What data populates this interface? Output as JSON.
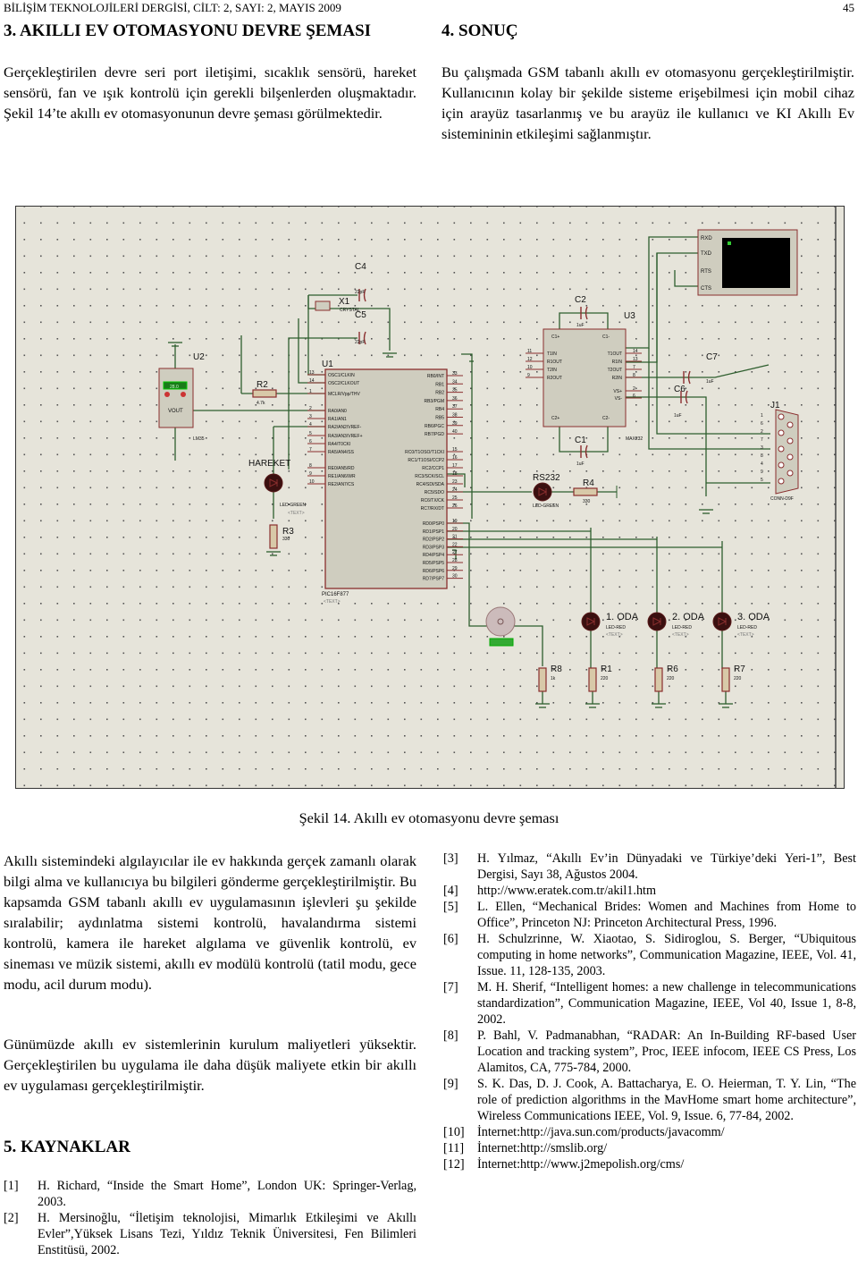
{
  "header": {
    "journal": "BİLİŞİM TEKNOLOJİLERİ DERGİSİ, CİLT: 2, SAYI: 2, MAYIS 2009",
    "page": "45"
  },
  "section3": {
    "title": "3. AKILLI EV OTOMASYONU DEVRE ŞEMASI",
    "text": "Gerçekleştirilen devre seri port iletişimi, sıcaklık sensörü, hareket sensörü, fan ve ışık kontrolü için gerekli bilşenlerden oluşmaktadır. Şekil 14’te akıllı ev otomasyonunun devre şeması görülmektedir."
  },
  "section4": {
    "title": "4. SONUÇ",
    "text": "Bu çalışmada GSM tabanlı akıllı ev otomasyonu gerçekleştirilmiştir. Kullanıcının kolay bir şekilde sisteme erişebilmesi için mobil cihaz için arayüz tasarlanmış ve bu arayüz ile kullanıcı ve KI Akıllı Ev sistemininin etkileşimi sağlanmıştır."
  },
  "figure": {
    "caption": "Şekil 14. Akıllı ev otomasyonu devre şeması",
    "labels": {
      "c4": "C4",
      "c4v": "22pF",
      "x1": "X1",
      "x1v": "CRYSTAL",
      "c5": "C5",
      "c5v": "22pF",
      "u1": "U1",
      "u1part": "PIC16F877",
      "u2": "U2",
      "u2part": "LM35",
      "u2pin": "VOUT",
      "u2val": "28.0",
      "r2": "R2",
      "r2v": "4.7k",
      "hareket": "HAREKET",
      "ledgreen": "LED-GREEN",
      "r3": "R3",
      "r3v": "330",
      "c2": "C2",
      "c2v": "1uF",
      "u3": "U3",
      "u3part": "MAX232",
      "c1": "C1",
      "c1v": "1uF",
      "c6": "C6",
      "c6v": "1uF",
      "c7": "C7",
      "c7v": "1uF",
      "j1": "J1",
      "j1part": "CONN-D9F",
      "rs232": "RS232",
      "ledgreen2": "LED-GREEN",
      "r4": "R4",
      "r4v": "330",
      "oda1": "1. ODA",
      "oda2": "2. ODA",
      "oda3": "3. ODA",
      "ledred": "LED-RED",
      "r8": "R8",
      "r8v": "1k",
      "r1": "R1",
      "r1v": "220",
      "r6": "R6",
      "r6v": "220",
      "r7": "R7",
      "r7v": "220",
      "text": "<TEXT>",
      "term": [
        "RXD",
        "TXD",
        "RTS",
        "CTS"
      ]
    },
    "u1_left": [
      [
        "13",
        "OSC1/CLKIN"
      ],
      [
        "14",
        "OSC2/CLKOUT"
      ],
      [
        "1",
        "MCLR/Vpp/THV"
      ],
      [
        "2",
        "RA0/AN0"
      ],
      [
        "3",
        "RA1/AN1"
      ],
      [
        "4",
        "RA2/AN2/VREF-"
      ],
      [
        "5",
        "RA3/AN3/VREF+"
      ],
      [
        "6",
        "RA4/T0CKI"
      ],
      [
        "7",
        "RA5/AN4/SS"
      ],
      [
        "8",
        "RE0/AN5/RD"
      ],
      [
        "9",
        "RE1/AN6/WR"
      ],
      [
        "10",
        "RE2/AN7/CS"
      ]
    ],
    "u1_right": [
      [
        "33",
        "RB0/INT"
      ],
      [
        "34",
        "RB1"
      ],
      [
        "35",
        "RB2"
      ],
      [
        "36",
        "RB3/PGM"
      ],
      [
        "37",
        "RB4"
      ],
      [
        "38",
        "RB5"
      ],
      [
        "39",
        "RB6/PGC"
      ],
      [
        "40",
        "RB7/PGD"
      ],
      [
        "15",
        "RC0/T1OSO/T1CKI"
      ],
      [
        "16",
        "RC1/T1OSI/CCP2"
      ],
      [
        "17",
        "RC2/CCP1"
      ],
      [
        "18",
        "RC3/SCK/SCL"
      ],
      [
        "23",
        "RC4/SDI/SDA"
      ],
      [
        "24",
        "RC5/SDO"
      ],
      [
        "25",
        "RC6/TX/CK"
      ],
      [
        "26",
        "RC7/RX/DT"
      ],
      [
        "19",
        "RD0/PSP0"
      ],
      [
        "20",
        "RD1/PSP1"
      ],
      [
        "21",
        "RD2/PSP2"
      ],
      [
        "22",
        "RD3/PSP3"
      ],
      [
        "27",
        "RD4/PSP4"
      ],
      [
        "28",
        "RD5/PSP5"
      ],
      [
        "29",
        "RD6/PSP6"
      ],
      [
        "30",
        "RD7/PSP7"
      ]
    ],
    "u3_left": [
      [
        "11",
        "T1IN"
      ],
      [
        "12",
        "R1OUT"
      ],
      [
        "10",
        "T2IN"
      ],
      [
        "9",
        "R2OUT"
      ]
    ],
    "u3_right": [
      [
        "14",
        "T1OUT"
      ],
      [
        "13",
        "R1IN"
      ],
      [
        "7",
        "T2OUT"
      ],
      [
        "8",
        "R2IN"
      ],
      [
        "2",
        "VS+"
      ],
      [
        "6",
        "VS-"
      ]
    ],
    "u3_caps": [
      "C1+",
      "C1-",
      "C2+",
      "C2-"
    ],
    "j1_pins": [
      "1",
      "6",
      "2",
      "7",
      "3",
      "8",
      "4",
      "9",
      "5"
    ],
    "colors": {
      "background": "#e6e4da",
      "wire": "#2e5e2e",
      "component": "#8a2e2e",
      "body": "#cfcdbf"
    }
  },
  "left_bottom": {
    "p1": "Akıllı sistemindeki algılayıcılar ile ev hakkında gerçek zamanlı olarak bilgi alma ve kullanıcıya bu bilgileri gönderme gerçekleştirilmiştir. Bu kapsamda GSM tabanlı akıllı ev uygulamasının işlevleri şu şekilde sıralabilir; aydınlatma sistemi kontrolü, havalandırma sistemi kontrolü, kamera ile hareket algılama ve güvenlik kontrolü, ev sineması ve müzik sistemi, akıllı ev modülü kontrolü (tatil modu, gece modu, acil durum modu).",
    "p2": "Günümüzde akıllı ev sistemlerinin kurulum maliyetleri yüksektir. Gerçekleştirilen bu uygulama ile daha düşük maliyete etkin bir akıllı ev uygulaması gerçekleştirilmiştir."
  },
  "section5": {
    "title": "5. KAYNAKLAR"
  },
  "references": [
    {
      "n": "[1]",
      "t": "H. Richard, “Inside the Smart Home”, London UK: Springer-Verlag, 2003."
    },
    {
      "n": "[2]",
      "t": "H. Mersinoğlu, “İletişim teknolojisi, Mimarlık Etkileşimi ve Akıllı Evler”,Yüksek Lisans Tezi, Yıldız Teknik Üniversitesi, Fen Bilimleri Enstitüsü, 2002."
    },
    {
      "n": "[3]",
      "t": "H. Yılmaz, “Akıllı Ev’in Dünyadaki ve Türkiye’deki Yeri-1”, Best Dergisi, Sayı 38, Ağustos 2004."
    },
    {
      "n": "[4]",
      "t": "http://www.eratek.com.tr/akil1.htm"
    },
    {
      "n": "[5]",
      "t": "L. Ellen, “Mechanical Brides: Women and Machines from Home to Office”, Princeton NJ: Princeton Architectural Press, 1996."
    },
    {
      "n": "[6]",
      "t": "H. Schulzrinne, W. Xiaotao, S. Sidiroglou, S. Berger, “Ubiquitous computing in home networks”, Communication Magazine, IEEE, Vol. 41, Issue. 11, 128-135, 2003."
    },
    {
      "n": "[7]",
      "t": "M. H. Sherif, “Intelligent homes: a new challenge in telecommunications standardization”, Communication Magazine, IEEE, Vol 40, Issue 1, 8-8, 2002."
    },
    {
      "n": "[8]",
      "t": "P. Bahl, V. Padmanabhan, “RADAR: An In-Building RF-based User Location and tracking system”, Proc, IEEE infocom, IEEE CS Press, Los Alamitos, CA, 775-784, 2000."
    },
    {
      "n": "[9]",
      "t": "S. K. Das, D. J. Cook, A. Battacharya, E. O. Heierman, T. Y. Lin, “The role of prediction algorithms in the MavHome smart home architecture”, Wireless Communications IEEE, Vol. 9, Issue. 6, 77-84, 2002."
    },
    {
      "n": "[10]",
      "t": "İnternet:http://java.sun.com/products/javacomm/"
    },
    {
      "n": "[11]",
      "t": "İnternet:http://smslib.org/"
    },
    {
      "n": "[12]",
      "t": "İnternet:http://www.j2mepolish.org/cms/"
    }
  ]
}
